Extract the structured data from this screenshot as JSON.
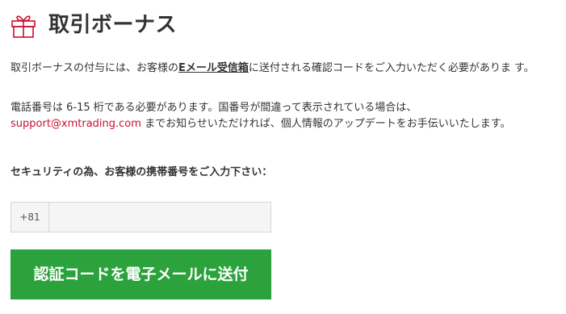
{
  "header": {
    "icon": "gift-icon",
    "title": "取引ボーナス",
    "accent_color": "#c8102e"
  },
  "intro": {
    "part1": "取引ボーナスの付与には、お客様の",
    "email_link": "Eメール受信箱",
    "part2": "に送付される確認コードをご入力いただく必要がありま す。"
  },
  "notice": {
    "part1": "電話番号は 6-15 桁である必要があります。国番号が間違って表示されている場合は、",
    "support_email": "support@xmtrading.com",
    "part2": " までお知らせいただければ、個人情報のアップデートをお手伝いいたします。"
  },
  "form": {
    "label": "セキュリティの為、お客様の携帯番号をご入力下さい：",
    "country_code": "+81",
    "phone_value": "",
    "submit_label": "認証コードを電子メールに送付",
    "button_color": "#2ba23c"
  }
}
